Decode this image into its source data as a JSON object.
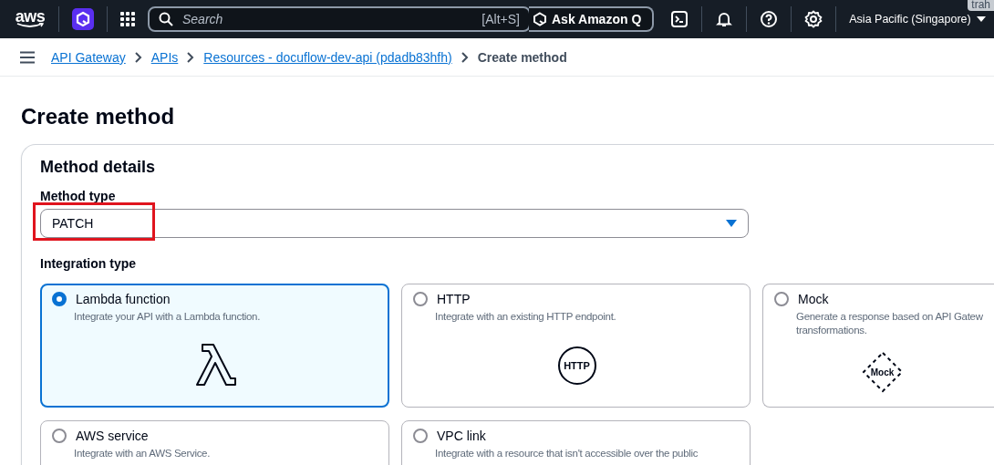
{
  "topbar": {
    "logo": "aws",
    "search": {
      "placeholder": "Search",
      "shortcut": "[Alt+S]"
    },
    "ask_button": "Ask Amazon Q",
    "region": "Asia Pacific (Singapore)",
    "corner_tag": "trah"
  },
  "breadcrumbs": [
    {
      "label": "API Gateway",
      "link": true
    },
    {
      "label": "APIs",
      "link": true
    },
    {
      "label": "Resources - docuflow-dev-api (pdadb83hfh)",
      "link": true
    },
    {
      "label": "Create method",
      "link": false
    }
  ],
  "page_title": "Create method",
  "panel": {
    "title": "Method details",
    "method_type": {
      "label": "Method type",
      "value": "PATCH",
      "highlighted": true
    },
    "integration_type": {
      "label": "Integration type",
      "options": [
        {
          "kind": "lambda",
          "title": "Lambda function",
          "description": [
            "Integrate your API with a Lambda function."
          ],
          "selected": true
        },
        {
          "kind": "http",
          "title": "HTTP",
          "description": [
            "Integrate with an existing HTTP endpoint."
          ],
          "selected": false,
          "icon_text": "HTTP"
        },
        {
          "kind": "mock",
          "title": "Mock",
          "description": [
            "Generate a response based on API Gatew",
            "transformations."
          ],
          "selected": false,
          "icon_text": "Mock"
        },
        {
          "kind": "none",
          "title": "AWS service",
          "description": [
            "Integrate with an AWS Service."
          ],
          "selected": false
        },
        {
          "kind": "none",
          "title": "VPC link",
          "description": [
            "Integrate with a resource that isn't accessible over the public"
          ],
          "selected": false
        }
      ]
    }
  }
}
